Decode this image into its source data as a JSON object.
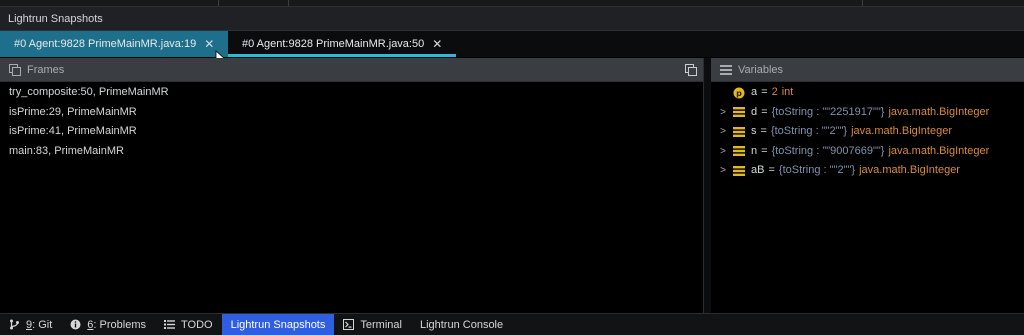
{
  "tool_window": {
    "title": "Lightrun Snapshots"
  },
  "tabs": [
    {
      "label": "#0 Agent:9828 PrimeMainMR.java:19",
      "close": "✕"
    },
    {
      "label": "#0 Agent:9828 PrimeMainMR.java:50",
      "close": "✕"
    }
  ],
  "frames": {
    "title": "Frames",
    "items": [
      "try_composite:50, PrimeMainMR",
      "isPrime:29, PrimeMainMR",
      "isPrime:41, PrimeMainMR",
      "main:83, PrimeMainMR"
    ]
  },
  "variables": {
    "title": "Variables",
    "items": [
      {
        "name": "a",
        "eq": "=",
        "value": "2",
        "type": "int",
        "icon": "primitive-icon",
        "expandable": false
      },
      {
        "name": "d",
        "eq": "=",
        "value": "{toString : \"\"2251917\"\"}",
        "type": "java.math.BigInteger",
        "icon": "field-icon",
        "expandable": true
      },
      {
        "name": "s",
        "eq": "=",
        "value": "{toString : \"\"2\"\"}",
        "type": "java.math.BigInteger",
        "icon": "field-icon",
        "expandable": true
      },
      {
        "name": "n",
        "eq": "=",
        "value": "{toString : \"\"9007669\"\"}",
        "type": "java.math.BigInteger",
        "icon": "field-icon",
        "expandable": true
      },
      {
        "name": "aB",
        "eq": "=",
        "value": "{toString : \"\"2\"\"}",
        "type": "java.math.BigInteger",
        "icon": "field-icon",
        "expandable": true
      }
    ]
  },
  "statusbar": {
    "git": {
      "mnemonic": "9",
      "label": ": Git"
    },
    "problems": {
      "mnemonic": "6",
      "label": ": Problems"
    },
    "todo": "TODO",
    "lightrun_snapshots": "Lightrun Snapshots",
    "terminal": "Terminal",
    "lightrun_console": "Lightrun Console"
  },
  "colors": {
    "accent": "#28b8e0",
    "active_tab": "#1d6f8b",
    "status_active": "#2f5fe0"
  }
}
